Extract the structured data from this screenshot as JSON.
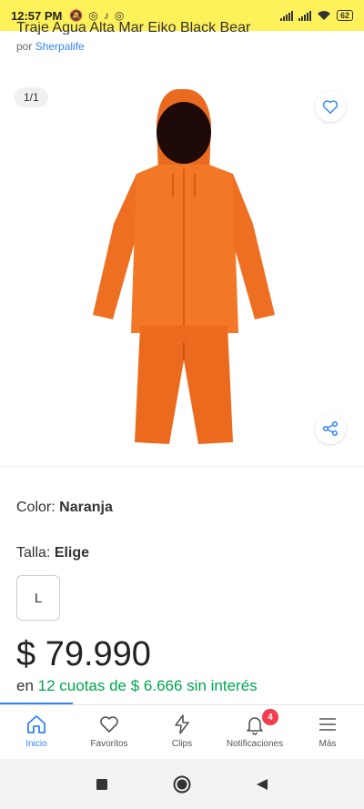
{
  "status_bar": {
    "time": "12:57 PM",
    "battery": "62",
    "icons_left": [
      "alarm-off-icon",
      "instagram-icon",
      "tiktok-icon",
      "instagram-icon"
    ]
  },
  "product": {
    "title": "Traje Agua Alta Mar Eiko Black Bear",
    "seller_prefix": "por",
    "seller_name": "Sherpalife",
    "gallery_counter": "1/1",
    "color_label": "Color:",
    "color_value": "Naranja",
    "size_label": "Talla:",
    "size_value": "Elige",
    "size_option": "L",
    "price": "$ 79.990",
    "installments_prefix": "en",
    "installments_text": "12 cuotas de $ 6.666 sin interés"
  },
  "bottom_nav": {
    "items": [
      {
        "label": "Inicio",
        "icon": "home-icon",
        "active": true
      },
      {
        "label": "Favoritos",
        "icon": "heart-icon"
      },
      {
        "label": "Clips",
        "icon": "lightning-icon"
      },
      {
        "label": "Notificaciones",
        "icon": "bell-icon",
        "badge": "4"
      },
      {
        "label": "Más",
        "icon": "menu-icon"
      }
    ]
  },
  "colors": {
    "brand_yellow": "#fff159",
    "accent_blue": "#3483fa",
    "installment_green": "#00a650",
    "product_orange": "#f26a1b"
  }
}
